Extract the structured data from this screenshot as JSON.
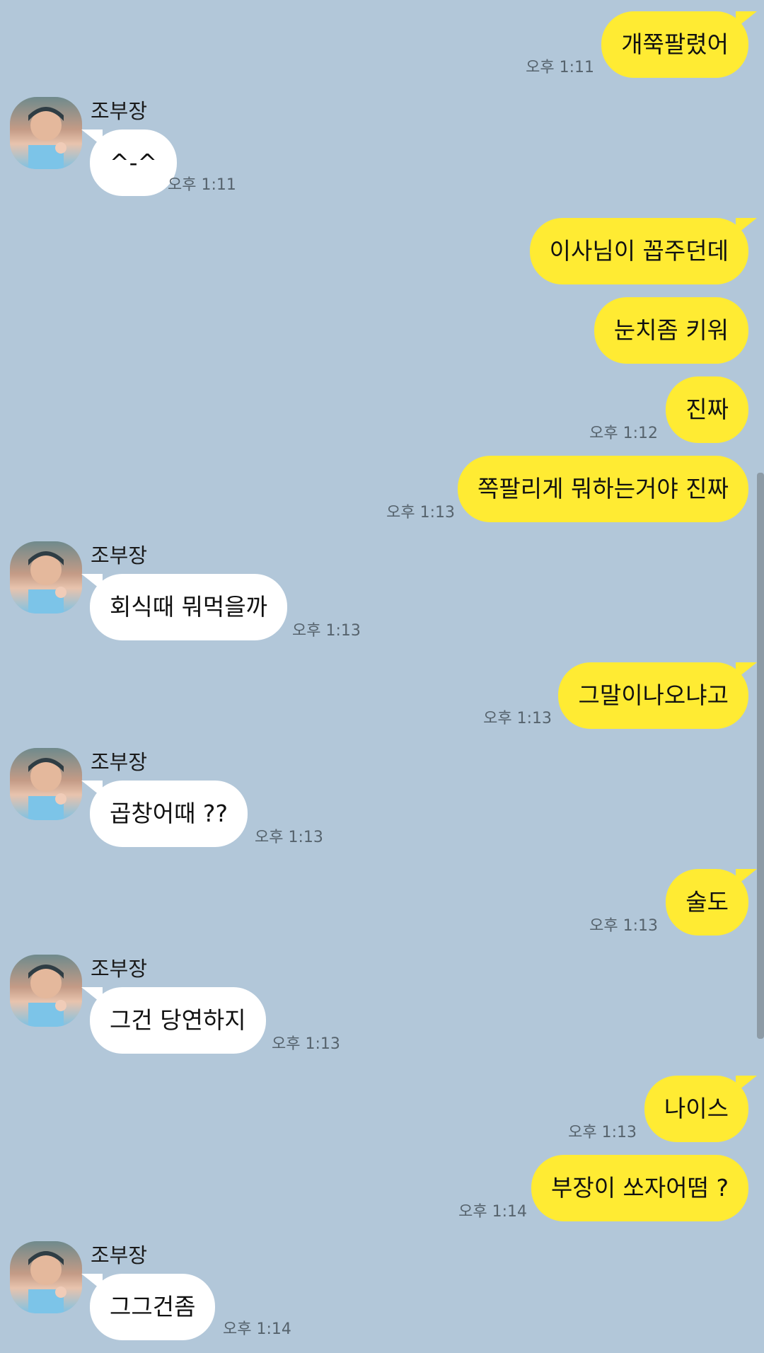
{
  "messages": [
    {
      "text": "개쭉팔렸어",
      "time": "오후 1:11"
    },
    {
      "sender": "조부장",
      "text": "^-^",
      "time": "오후 1:11"
    },
    {
      "text": "이사님이 꼽주던데"
    },
    {
      "text": "눈치좀 키워"
    },
    {
      "text": "진짜",
      "time": "오후 1:12"
    },
    {
      "text": "쪽팔리게 뭐하는거야 진짜",
      "time": "오후 1:13"
    },
    {
      "sender": "조부장",
      "text": "회식때 뭐먹을까",
      "time": "오후 1:13"
    },
    {
      "text": "그말이나오냐고",
      "time": "오후 1:13"
    },
    {
      "sender": "조부장",
      "text": "곱창어때 ??",
      "time": "오후 1:13"
    },
    {
      "text": "술도",
      "time": "오후 1:13"
    },
    {
      "sender": "조부장",
      "text": "그건 당연하지",
      "time": "오후 1:13"
    },
    {
      "text": "나이스",
      "time": "오후 1:13"
    },
    {
      "text": "부장이 쏘자어떰 ?",
      "time": "오후 1:14"
    },
    {
      "sender": "조부장",
      "text": "그그건좀",
      "time": "오후 1:14"
    }
  ],
  "colors": {
    "background": "#b2c7d9",
    "my_bubble": "#ffeb33",
    "their_bubble": "#ffffff",
    "timestamp": "#56636d"
  },
  "icons": {
    "avatar": "profile-photo-avatar"
  }
}
